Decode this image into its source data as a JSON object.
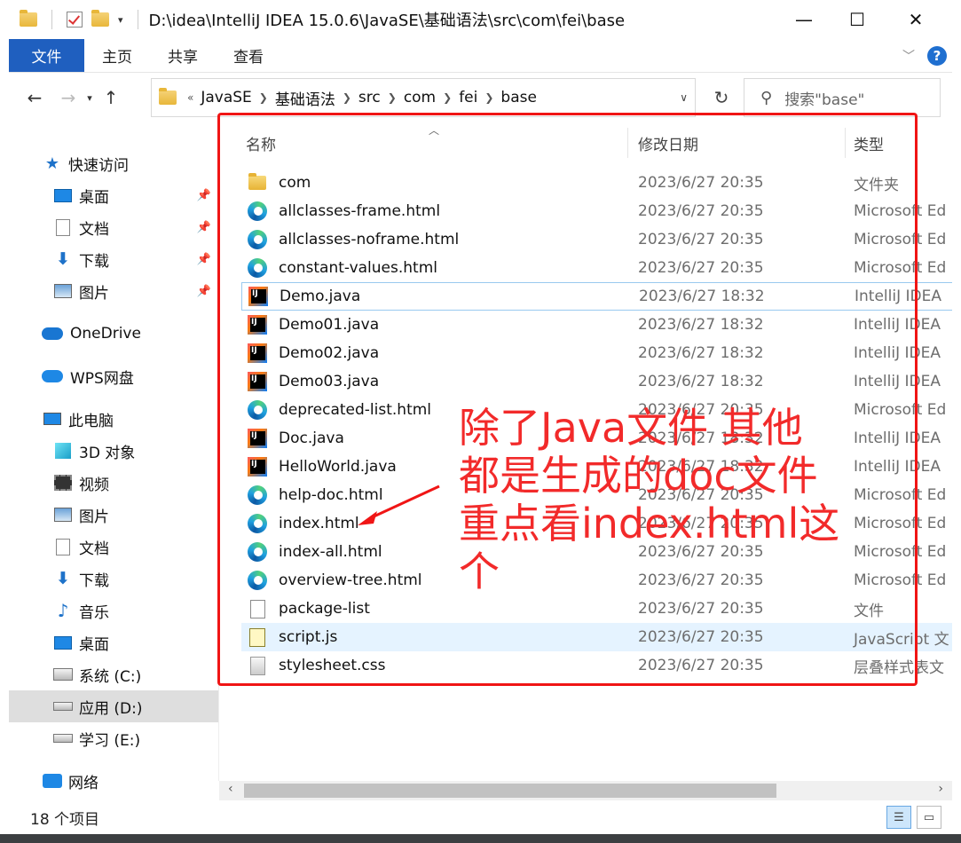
{
  "window": {
    "title": "D:\\idea\\IntelliJ IDEA 15.0.6\\JavaSE\\基础语法\\src\\com\\fei\\base",
    "minimize": "—",
    "maximize": "☐",
    "close": "✕"
  },
  "ribbon": {
    "tabs": [
      "文件",
      "主页",
      "共享",
      "查看"
    ],
    "help": "?"
  },
  "address": {
    "overflow": "«",
    "crumbs": [
      "JavaSE",
      "基础语法",
      "src",
      "com",
      "fei",
      "base"
    ]
  },
  "search": {
    "placeholder": "搜索\"base\""
  },
  "sidebar": {
    "items": [
      {
        "label": "快速访问",
        "icon": "star-icon"
      },
      {
        "label": "桌面",
        "icon": "desktop-icon",
        "pinned": true
      },
      {
        "label": "文档",
        "icon": "document-icon",
        "pinned": true
      },
      {
        "label": "下载",
        "icon": "download-icon",
        "pinned": true
      },
      {
        "label": "图片",
        "icon": "picture-icon",
        "pinned": true
      },
      {
        "label": "OneDrive",
        "icon": "cloud-icon"
      },
      {
        "label": "WPS网盘",
        "icon": "cloud-icon"
      },
      {
        "label": "此电脑",
        "icon": "computer-icon"
      },
      {
        "label": "3D 对象",
        "icon": "cube-icon"
      },
      {
        "label": "视频",
        "icon": "video-icon"
      },
      {
        "label": "图片",
        "icon": "picture-icon"
      },
      {
        "label": "文档",
        "icon": "document-icon"
      },
      {
        "label": "下载",
        "icon": "download-icon"
      },
      {
        "label": "音乐",
        "icon": "music-icon"
      },
      {
        "label": "桌面",
        "icon": "desktop-icon"
      },
      {
        "label": "系统 (C:)",
        "icon": "drive-icon"
      },
      {
        "label": "应用 (D:)",
        "icon": "drive-icon",
        "selected": true
      },
      {
        "label": "学习 (E:)",
        "icon": "drive-icon"
      },
      {
        "label": "网络",
        "icon": "network-icon"
      }
    ]
  },
  "columns": {
    "name": "名称",
    "date": "修改日期",
    "type": "类型"
  },
  "files": [
    {
      "name": "com",
      "date": "2023/6/27 20:35",
      "type": "文件夹",
      "icon": "folder-icon"
    },
    {
      "name": "allclasses-frame.html",
      "date": "2023/6/27 20:35",
      "type": "Microsoft Ed",
      "icon": "edge-icon"
    },
    {
      "name": "allclasses-noframe.html",
      "date": "2023/6/27 20:35",
      "type": "Microsoft Ed",
      "icon": "edge-icon"
    },
    {
      "name": "constant-values.html",
      "date": "2023/6/27 20:35",
      "type": "Microsoft Ed",
      "icon": "edge-icon"
    },
    {
      "name": "Demo.java",
      "date": "2023/6/27 18:32",
      "type": "IntelliJ IDEA",
      "icon": "intellij-icon",
      "focused": true
    },
    {
      "name": "Demo01.java",
      "date": "2023/6/27 18:32",
      "type": "IntelliJ IDEA",
      "icon": "intellij-icon"
    },
    {
      "name": "Demo02.java",
      "date": "2023/6/27 18:32",
      "type": "IntelliJ IDEA",
      "icon": "intellij-icon"
    },
    {
      "name": "Demo03.java",
      "date": "2023/6/27 18:32",
      "type": "IntelliJ IDEA",
      "icon": "intellij-icon"
    },
    {
      "name": "deprecated-list.html",
      "date": "2023/6/27 20:35",
      "type": "Microsoft Ed",
      "icon": "edge-icon"
    },
    {
      "name": "Doc.java",
      "date": "2023/6/27 18:32",
      "type": "IntelliJ IDEA",
      "icon": "intellij-icon"
    },
    {
      "name": "HelloWorld.java",
      "date": "2023/6/27 18:32",
      "type": "IntelliJ IDEA",
      "icon": "intellij-icon"
    },
    {
      "name": "help-doc.html",
      "date": "2023/6/27 20:35",
      "type": "Microsoft Ed",
      "icon": "edge-icon"
    },
    {
      "name": "index.html",
      "date": "2023/6/27 20:35",
      "type": "Microsoft Ed",
      "icon": "edge-icon"
    },
    {
      "name": "index-all.html",
      "date": "2023/6/27 20:35",
      "type": "Microsoft Ed",
      "icon": "edge-icon"
    },
    {
      "name": "overview-tree.html",
      "date": "2023/6/27 20:35",
      "type": "Microsoft Ed",
      "icon": "edge-icon"
    },
    {
      "name": "package-list",
      "date": "2023/6/27 20:35",
      "type": "文件",
      "icon": "blank-file-icon"
    },
    {
      "name": "script.js",
      "date": "2023/6/27 20:35",
      "type": "JavaScript 文",
      "icon": "javascript-file-icon",
      "hover": true
    },
    {
      "name": "stylesheet.css",
      "date": "2023/6/27 20:35",
      "type": "层叠样式表文",
      "icon": "css-file-icon"
    }
  ],
  "annotation": {
    "lines": [
      "除了Java文件 其他",
      "都是生成的doc文件",
      "重点看index.html这",
      "个"
    ],
    "color": "#f01515"
  },
  "status": {
    "item_count": "18 个项目"
  },
  "colors": {
    "file_tab": "#1f5fbf",
    "selected_sidebar": "#dedede",
    "hover_row": "#e5f3ff"
  }
}
